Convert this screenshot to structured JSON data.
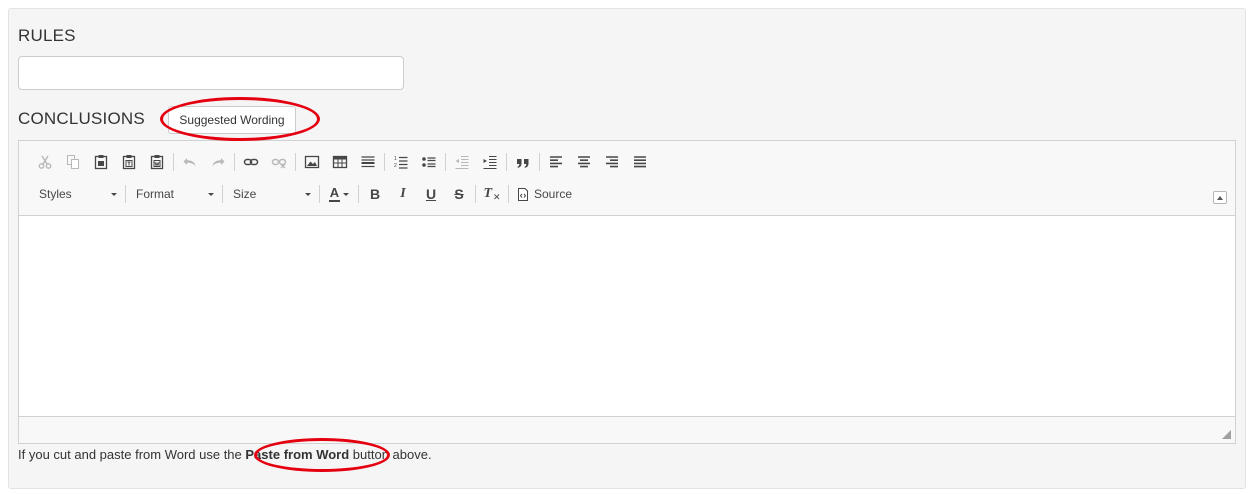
{
  "rules": {
    "label": "RULES",
    "input_value": "",
    "input_placeholder": ""
  },
  "conclusions": {
    "label": "CONCLUSIONS",
    "suggested_wording_label": "Suggested Wording"
  },
  "editor": {
    "toolbar_row1_icons": [
      "cut-icon",
      "copy-icon",
      "paste-icon",
      "paste-text-icon",
      "paste-word-icon",
      "undo-icon",
      "redo-icon",
      "link-icon",
      "unlink-icon",
      "image-icon",
      "table-icon",
      "horizontal-rule-icon",
      "numbered-list-icon",
      "bulleted-list-icon",
      "outdent-icon",
      "indent-icon",
      "blockquote-icon",
      "align-left-icon",
      "align-center-icon",
      "align-right-icon",
      "justify-icon"
    ],
    "combos": {
      "styles": "Styles",
      "format": "Format",
      "size": "Size"
    },
    "text_color_label": "A",
    "bold_label": "B",
    "italic_label": "I",
    "underline_label": "U",
    "strike_label": "S",
    "clear_format_label": "T",
    "source_label": "Source",
    "content": ""
  },
  "help": {
    "prefix": "If you cut and paste from Word use the ",
    "bold": "Paste from Word",
    "suffix": " button above."
  },
  "colors": {
    "annotation": "#e4000f",
    "panel_bg": "#f5f5f5",
    "toolbar_bg": "#f8f8f8"
  }
}
